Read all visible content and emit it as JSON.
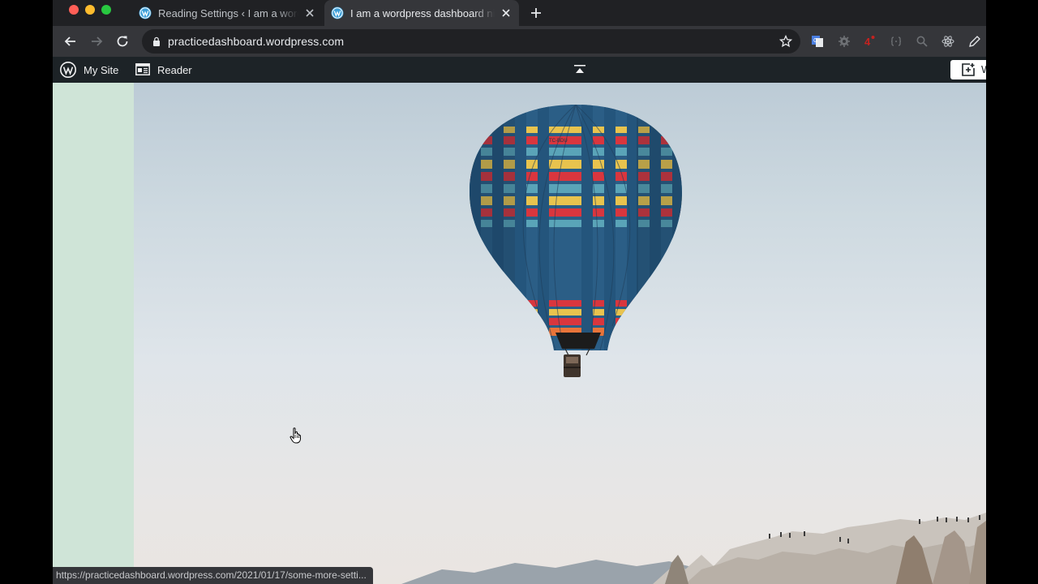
{
  "browser": {
    "tabs": [
      {
        "title": "Reading Settings ‹ I am a word",
        "active": false
      },
      {
        "title": "I am a wordpress dashboard ni",
        "active": true
      }
    ],
    "new_tab_label": "+",
    "url": "practicedashboard.wordpress.com",
    "status_url": "https://practicedashboard.wordpress.com/2021/01/17/some-more-setti...",
    "extensions": [
      "translate-icon",
      "gear-extension-icon",
      "counter-extension-icon",
      "brackets-extension-icon",
      "magnifier-extension-icon",
      "react-icon",
      "pencil-extension-icon"
    ],
    "extension_badge": "4"
  },
  "admin_bar": {
    "my_site_label": "My Site",
    "reader_label": "Reader",
    "write_label": "W"
  },
  "hero": {
    "balloon_tag": "TC-BDU"
  },
  "colors": {
    "sidebar_strip": "#cfe4d7",
    "admin_bar": "#1d2327",
    "toolbar": "#35363a"
  }
}
